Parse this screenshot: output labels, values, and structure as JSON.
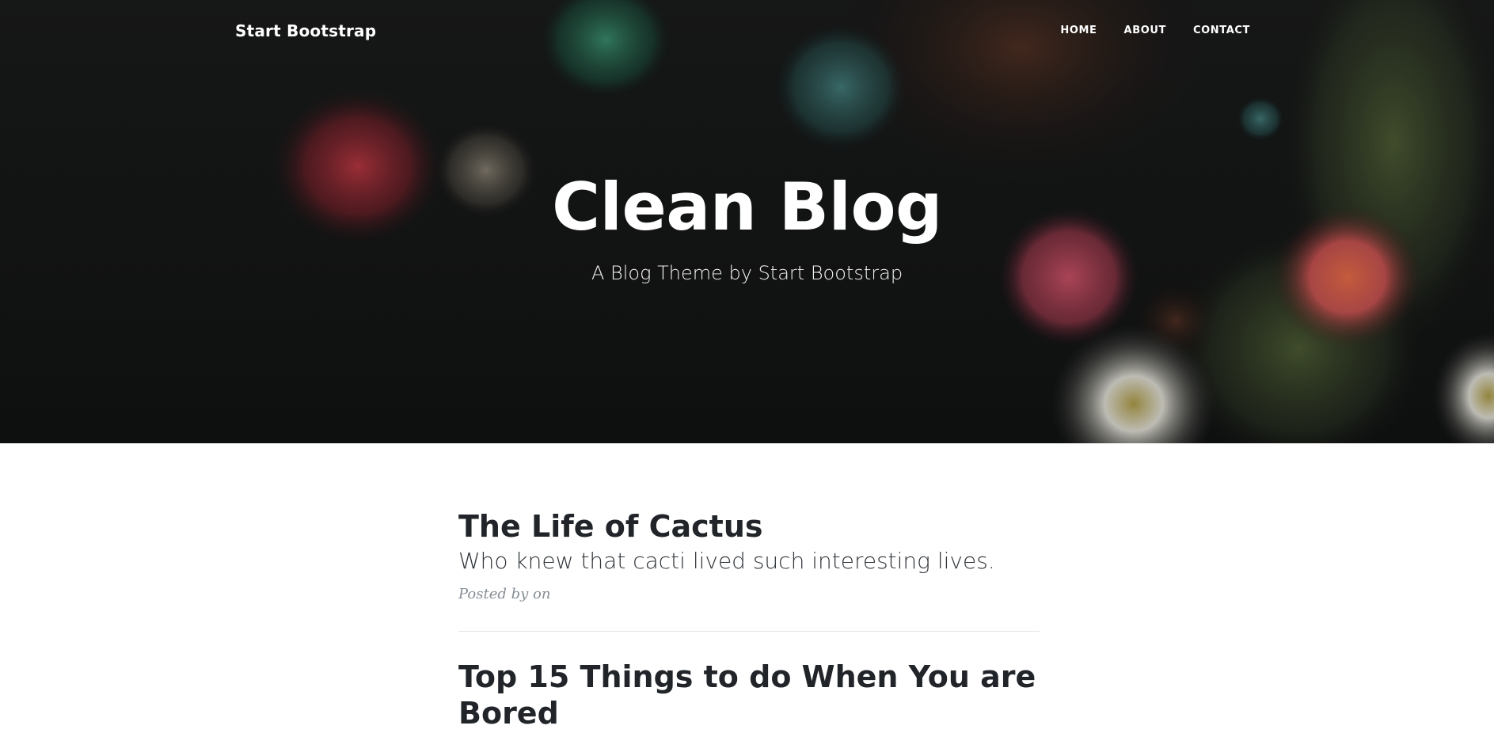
{
  "navbar": {
    "brand": "Start Bootstrap",
    "links": [
      {
        "label": "HOME"
      },
      {
        "label": "ABOUT"
      },
      {
        "label": "CONTACT"
      }
    ]
  },
  "hero": {
    "title": "Clean Blog",
    "subtitle": "A Blog Theme by Start Bootstrap"
  },
  "posts": [
    {
      "title": "The Life of Cactus",
      "subtitle": "Who knew that cacti lived such interesting lives.",
      "meta": "Posted by on"
    },
    {
      "title": "Top 15 Things to do When You are Bored"
    }
  ],
  "colors": {
    "hero_bg": "#171a1a",
    "heading_text": "#212529",
    "meta_text": "#868e96"
  }
}
